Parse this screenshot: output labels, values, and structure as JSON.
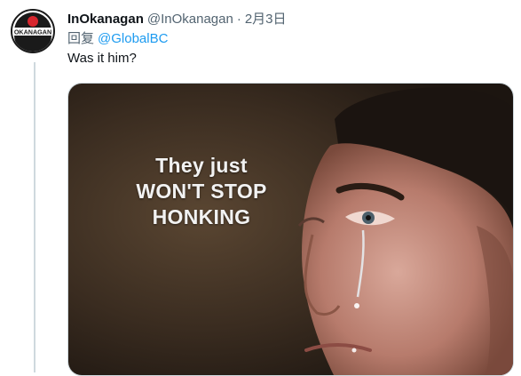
{
  "tweet": {
    "author": {
      "display_name": "InOkanagan",
      "handle": "@InOkanagan",
      "avatar_text": "OKANAGAN",
      "avatar_icon": "okanagan-logo"
    },
    "separator": "·",
    "timestamp": "2月3日",
    "reply_label": "回复",
    "reply_to": "@GlobalBC",
    "text": "Was it him?",
    "media": {
      "caption_lines": [
        "They just",
        "WON'T STOP",
        "HONKING"
      ]
    }
  },
  "colors": {
    "primary_text": "#0f1419",
    "secondary_text": "#536471",
    "link": "#1d9bf0",
    "thread_line": "#cfd9de",
    "logo_red": "#d7262e"
  }
}
